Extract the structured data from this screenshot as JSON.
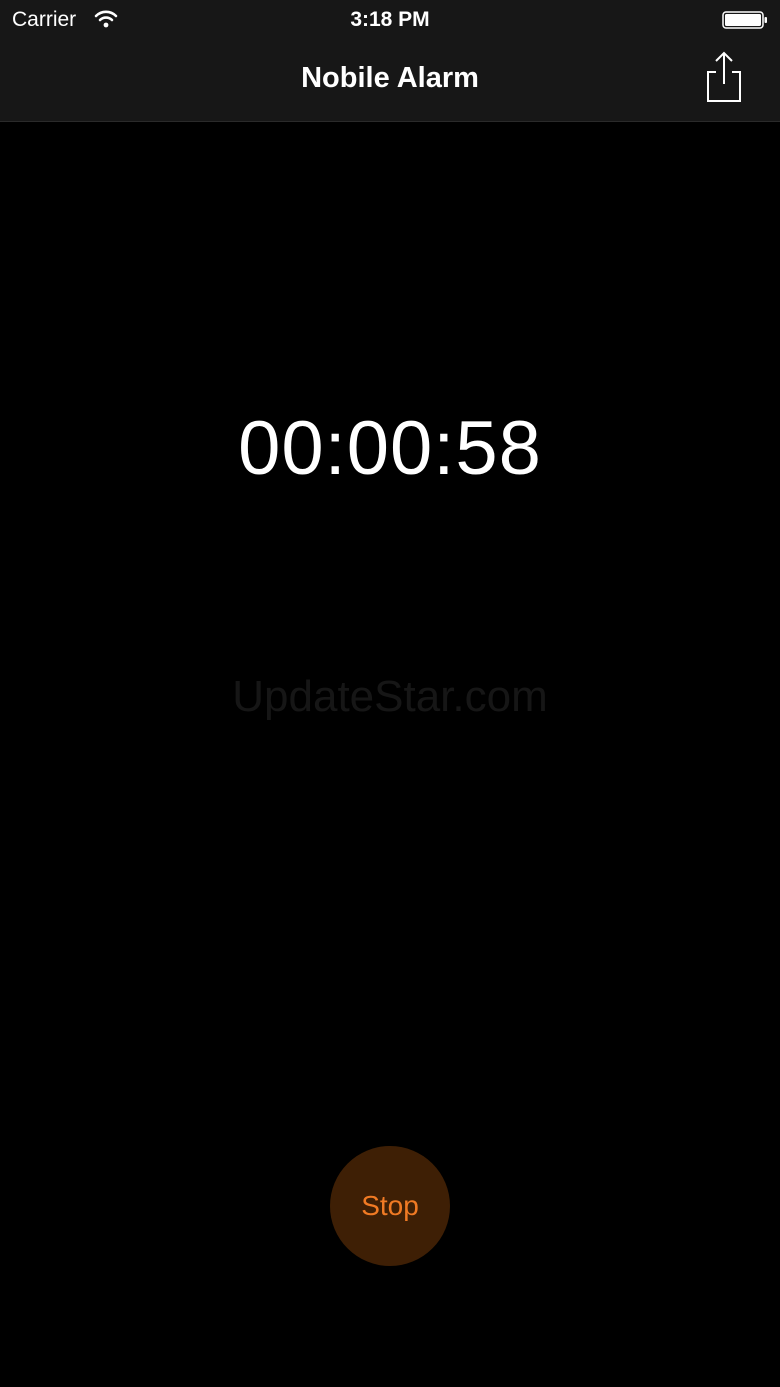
{
  "status_bar": {
    "carrier": "Carrier",
    "time": "3:18 PM",
    "wifi_icon": "wifi-icon",
    "battery_icon": "battery-icon"
  },
  "nav": {
    "title": "Nobile Alarm",
    "share_icon": "share-icon"
  },
  "main": {
    "timer": "00:00:58",
    "watermark": "UpdateStar.com"
  },
  "controls": {
    "stop_label": "Stop"
  },
  "colors": {
    "background": "#000000",
    "bar_background": "#171717",
    "stop_fill": "#3e1f05",
    "stop_text": "#f07a24"
  }
}
